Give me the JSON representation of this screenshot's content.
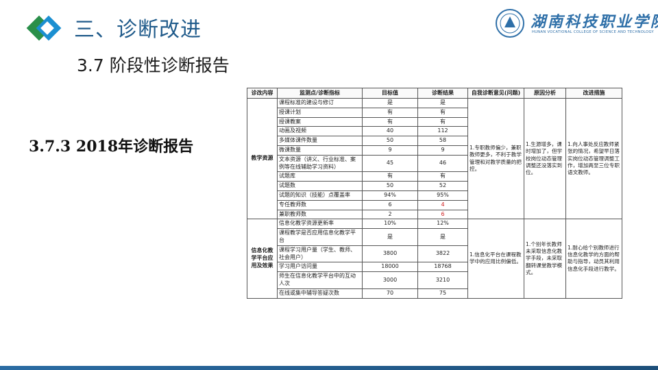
{
  "header": {
    "title": "三、诊断改进",
    "subtitle": "3.7 阶段性诊断报告",
    "school_name": "湖南科技职业学院",
    "school_name_en": "HUNAN VOCATIONAL COLLEGE OF SCIENCE AND TECHNOLOGY",
    "logo_icon": "blue-diamond-icon",
    "seal_icon": "school-seal-icon"
  },
  "section": {
    "heading": "3.7.3 2018年诊断报告"
  },
  "table": {
    "headers": [
      "诊改内容",
      "监测点/诊断指标",
      "目标值",
      "诊断结果",
      "自我诊断意见(问题)",
      "原因分析",
      "改进措施"
    ],
    "groups": [
      {
        "name": "教学资源",
        "opinion": "1.专职教师偏少，兼职教师更多，不利于教学管理和对教学质量的把控。",
        "cause": "1.生源增多，课时增加了，但学校岗位动态管理调整还没落实到位。",
        "measure": "1.向人事处反应教师紧张的情况，希望早日落实岗位动态管理调整工作，增加两至三位专职语文教师。",
        "rows": [
          {
            "indicator": "课程标准的建设与修订",
            "target": "是",
            "result": "是"
          },
          {
            "indicator": "授课计划",
            "target": "有",
            "result": "有"
          },
          {
            "indicator": "授课教案",
            "target": "有",
            "result": "有"
          },
          {
            "indicator": "动画及视频",
            "target": "40",
            "result": "112"
          },
          {
            "indicator": "多媒体课件数量",
            "target": "50",
            "result": "58"
          },
          {
            "indicator": "微课数量",
            "target": "9",
            "result": "9"
          },
          {
            "indicator": "文本资源（讲义、行业标准、案例等在线辅助学习资料）",
            "target": "45",
            "result": "46"
          },
          {
            "indicator": "试题库",
            "target": "有",
            "result": "有"
          },
          {
            "indicator": "试题数",
            "target": "50",
            "result": "52"
          },
          {
            "indicator": "试题的知识（技能）点覆盖率",
            "target": "94%",
            "result": "95%"
          },
          {
            "indicator": "专任教师数",
            "target": "6",
            "result": "4",
            "highlight": true
          },
          {
            "indicator": "兼职教师数",
            "target": "2",
            "result": "6",
            "highlight": true
          }
        ]
      },
      {
        "name": "信息化教学平台应用及效果",
        "opinion": "1.信息化平台在课程教学中的应用比例偏低。",
        "cause": "1.个别年长教师未采取信息化教学手段，未采取翻转课堂教学模式。",
        "measure": "1.耐心给个别教师进行信息化教学的方面的帮助与指导，动员其利用信息化手段进行教学。",
        "rows": [
          {
            "indicator": "信息化教学资源更新率",
            "target": "10%",
            "result": "12%"
          },
          {
            "indicator": "课程教学是否应用信息化教学平台",
            "target": "是",
            "result": "是"
          },
          {
            "indicator": "课程学习用户量（学生、教师、社会用户）",
            "target": "3800",
            "result": "3822"
          },
          {
            "indicator": "学习用户访问量",
            "target": "18000",
            "result": "18768"
          },
          {
            "indicator": "师生在信息化教学平台中的互动人次",
            "target": "3000",
            "result": "3210"
          },
          {
            "indicator": "在线或集中辅导答疑次数",
            "target": "70",
            "result": "75"
          }
        ]
      }
    ]
  },
  "colors": {
    "title": "#1f5a8a",
    "logo_blue": "#1b8fd1",
    "logo_green": "#2a8f4a",
    "highlight_red": "#d02020"
  }
}
